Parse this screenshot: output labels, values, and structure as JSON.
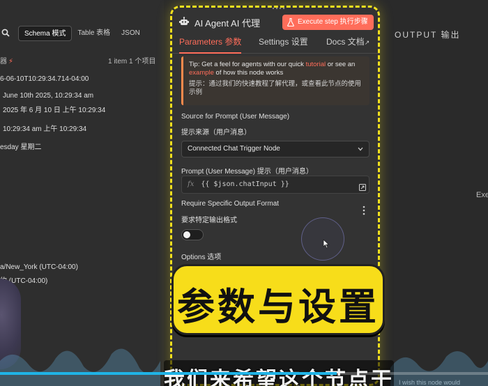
{
  "left": {
    "tabs": [
      {
        "label": "Schema 模式",
        "active": true
      },
      {
        "label": "Table 表格",
        "active": false
      },
      {
        "label": "JSON",
        "active": false
      }
    ],
    "node_title": "器",
    "item_count": "1 item 1 个项目",
    "rows": [
      "6-06-10T10:29:34.714-04:00",
      "June 10th 2025, 10:29:34 am",
      "2025 年 6 月 10 日 上午 10:29:34",
      "10:29:34 am 上午 10:29:34",
      "esday 星期二",
      "a/New_York (UTC-04:00)",
      "约 (UTC-04:00)"
    ]
  },
  "node": {
    "name": "AI Agent AI 代理",
    "execute_label": "Execute step 执行步骤",
    "tabs": [
      "Parameters 参数",
      "Settings 设置",
      "Docs 文档"
    ],
    "tip": {
      "prefix": "Tip: Get a feel for agents with our quick ",
      "link1": "tutorial",
      "mid": " or see an ",
      "link2": "example",
      "suffix": " of how this node works",
      "zh": "提示：通过我们的快速教程了解代理，或查看此节点的使用示例"
    },
    "source_label_en": "Source for Prompt (User Message)",
    "source_label_zh": "提示来源（用户消息）",
    "source_value": "Connected Chat Trigger Node",
    "prompt_label": "Prompt (User Message)  提示（用户消息）",
    "prompt_fx": "fx",
    "prompt_value": "{{ $json.chatInput }}",
    "require_label_en": "Require Specific Output Format",
    "require_label_zh": "要求特定输出格式",
    "require_enabled": false,
    "options_label": "Options  选项"
  },
  "right": {
    "output_label": "OUTPUT 输出",
    "exec_hint": "Exe",
    "bottom_hint": "I wish this node would"
  },
  "overlay": {
    "big_caption": "参数与设置",
    "subtitle": "我们来希望这个节点干什么"
  },
  "colors": {
    "accent": "#ff6d5a",
    "highlight": "#f2e01e",
    "progress": "#1fb3e6"
  },
  "video_progress_percent": 69
}
